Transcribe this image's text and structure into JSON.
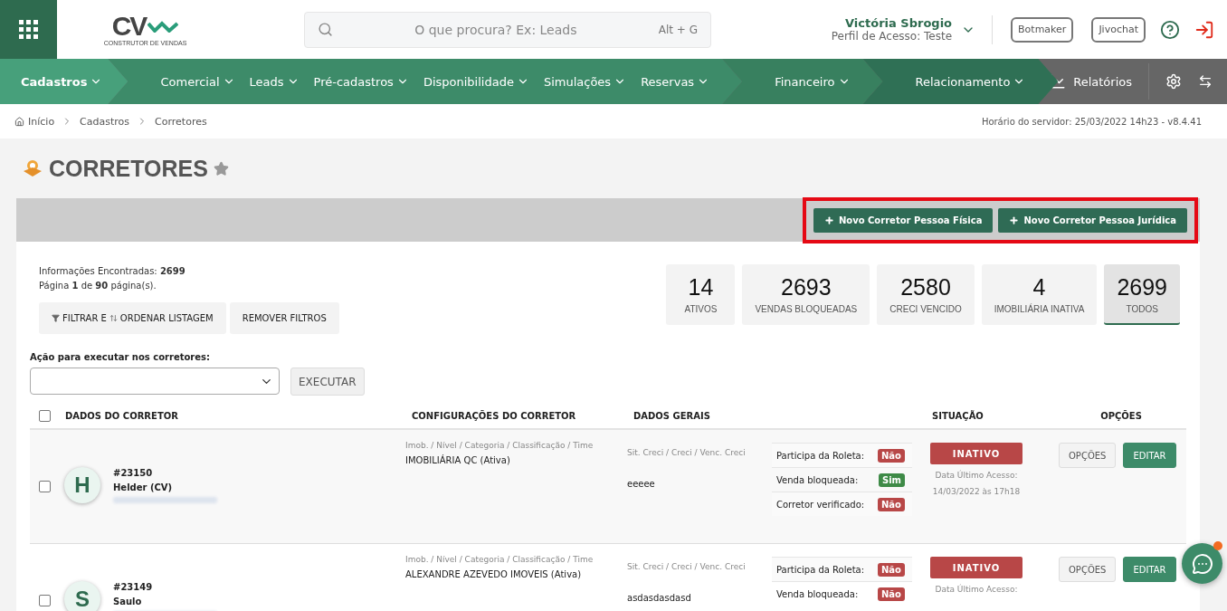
{
  "header": {
    "logo": {
      "mark": "CV",
      "tagline": "CONSTRUTOR DE VENDAS"
    },
    "search": {
      "placeholder": "O que procura? Ex: Leads",
      "shortcut": "Alt + G"
    },
    "user": {
      "name": "Victória Sbrogio",
      "profile": "Perfil de Acesso: Teste"
    },
    "buttons": [
      "Botmaker",
      "Jivochat"
    ]
  },
  "nav": {
    "segments": [
      {
        "items": [
          {
            "label": "Cadastros",
            "selected": true
          }
        ]
      },
      {
        "items": [
          {
            "label": "Comercial",
            "selected": false
          },
          {
            "label": "Leads",
            "selected": false
          },
          {
            "label": "Pré-cadastros",
            "selected": false
          },
          {
            "label": "Disponibilidade",
            "selected": false
          },
          {
            "label": "Simulações",
            "selected": false
          },
          {
            "label": "Reservas",
            "selected": false
          }
        ]
      },
      {
        "items": [
          {
            "label": "Financeiro",
            "selected": false
          }
        ]
      },
      {
        "items": [
          {
            "label": "Relacionamento",
            "selected": false
          }
        ]
      }
    ],
    "reports": "Relatórios"
  },
  "breadcrumb": [
    "Início",
    "Cadastros",
    "Corretores"
  ],
  "server_time": "Horário do servidor: 25/03/2022 14h23 - v8.4.41",
  "page_title": "CORRETORES",
  "actions": [
    "Novo Corretor Pessoa Física",
    "Novo Corretor Pessoa Jurídica"
  ],
  "info": [
    "Informações Encontradas: **2699**",
    "Página **1** de **90** página(s)."
  ],
  "filter_button": {
    "before": "FILTRAR E",
    "after": "ORDENAR LISTAGEM"
  },
  "remove_filters": "REMOVER FILTROS",
  "stats": [
    {
      "value": "14",
      "label": "ATIVOS",
      "selected": false
    },
    {
      "value": "2693",
      "label": "VENDAS BLOQUEADAS",
      "selected": false
    },
    {
      "value": "2580",
      "label": "CRECI VENCIDO",
      "selected": false
    },
    {
      "value": "4",
      "label": "IMOBILIÁRIA INATIVA",
      "selected": false
    },
    {
      "value": "2699",
      "label": "TODOS",
      "selected": true
    }
  ],
  "action": {
    "label": "Ação para executar nos corretores:",
    "button": "EXECUTAR"
  },
  "table": {
    "select_all": {
      "checked": false
    },
    "columns": [
      "DADOS DO CORRETOR",
      "CONFIGURAÇÕES DO CORRETOR",
      "DADOS GERAIS",
      "SITUAÇÃO",
      "OPÇÕES"
    ],
    "rows": [
      {
        "checked": false,
        "initial": "H",
        "id": "#23150",
        "name": "Helder (CV)",
        "config_label": "Imob. / Nível / Categoria / Classificação / Time",
        "config_value": "IMOBILIÁRIA QC (Ativa)",
        "creci_label": "Sit. Creci / Creci / Venc. Creci",
        "creci_value": "eeeee",
        "flags": [
          {
            "label": "Participa da Roleta:",
            "value": "Não",
            "on": false
          },
          {
            "label": "Venda bloqueada:",
            "value": "Sim",
            "on": true
          },
          {
            "label": "Corretor verificado:",
            "value": "Não",
            "on": false
          }
        ],
        "status": {
          "label": "INATIVO",
          "kind": "inactive"
        },
        "last_access_label": "Data Último Acesso:",
        "last_access": "14/03/2022 às 17h18",
        "buttons": [
          "OPÇÕES",
          "EDITAR"
        ]
      },
      {
        "checked": false,
        "initial": "S",
        "id": "#23149",
        "name": "Saulo",
        "config_label": "Imob. / Nível / Categoria / Classificação / Time",
        "config_value": "ALEXANDRE AZEVEDO IMOVEIS (Ativa)",
        "creci_label": "Sit. Creci / Creci / Venc. Creci",
        "creci_value": "asdasdasdasd",
        "flags": [
          {
            "label": "Participa da Roleta:",
            "value": "Não",
            "on": false
          },
          {
            "label": "Venda bloqueada:",
            "value": "Não",
            "on": false
          }
        ],
        "status": {
          "label": "INATIVO",
          "kind": "inactive"
        },
        "last_access_label": "Data Último Acesso:",
        "buttons": [
          "OPÇÕES",
          "EDITAR"
        ]
      }
    ]
  }
}
